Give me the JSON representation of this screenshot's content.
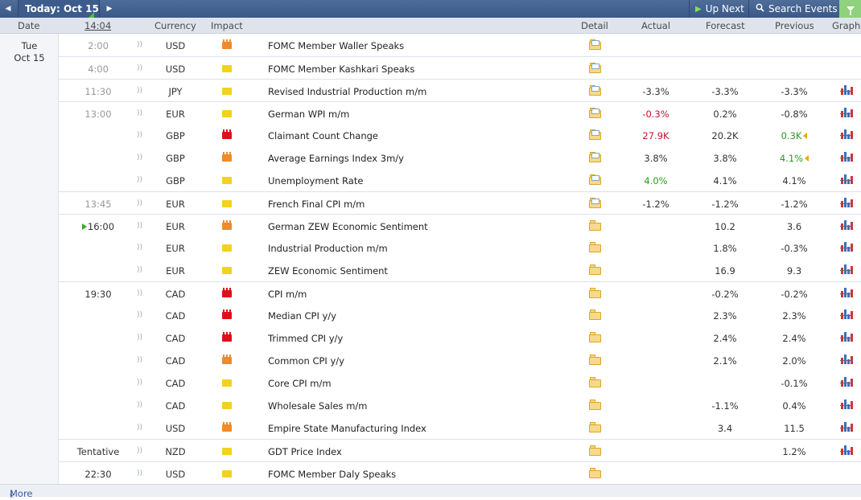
{
  "toolbar": {
    "prev_icon": "◀",
    "next_icon": "▶",
    "date_label": "Today: Oct 15",
    "up_next_label": "Up Next",
    "search_label": "Search Events"
  },
  "header": {
    "date": "Date",
    "time": "14:04",
    "currency": "Currency",
    "impact": "Impact",
    "detail": "Detail",
    "actual": "Actual",
    "forecast": "Forecast",
    "previous": "Previous",
    "graph": "Graph"
  },
  "day": {
    "weekday": "Tue",
    "date": "Oct 15"
  },
  "rows": [
    {
      "time": "2:00",
      "currency": "USD",
      "impact": "med",
      "event": "FOMC Member Waller Speaks",
      "actual": "",
      "actual_color": "",
      "forecast": "",
      "previous": "",
      "prev_color": "",
      "revised": false,
      "graph": false,
      "sep": false
    },
    {
      "time": "4:00",
      "currency": "USD",
      "impact": "low",
      "event": "FOMC Member Kashkari Speaks",
      "actual": "",
      "actual_color": "",
      "forecast": "",
      "previous": "",
      "prev_color": "",
      "revised": false,
      "graph": false,
      "sep": true
    },
    {
      "time": "11:30",
      "currency": "JPY",
      "impact": "low",
      "event": "Revised Industrial Production m/m",
      "actual": "-3.3%",
      "actual_color": "dark",
      "forecast": "-3.3%",
      "previous": "-3.3%",
      "prev_color": "",
      "revised": false,
      "graph": true,
      "sep": true
    },
    {
      "time": "13:00",
      "currency": "EUR",
      "impact": "low",
      "event": "German WPI m/m",
      "actual": "-0.3%",
      "actual_color": "red",
      "forecast": "0.2%",
      "previous": "-0.8%",
      "prev_color": "",
      "revised": false,
      "graph": true,
      "sep": true
    },
    {
      "time": "",
      "currency": "GBP",
      "impact": "high",
      "event": "Claimant Count Change",
      "actual": "27.9K",
      "actual_color": "red",
      "forecast": "20.2K",
      "previous": "0.3K",
      "prev_color": "green",
      "revised": true,
      "graph": true,
      "sep": false
    },
    {
      "time": "",
      "currency": "GBP",
      "impact": "med",
      "event": "Average Earnings Index 3m/y",
      "actual": "3.8%",
      "actual_color": "dark",
      "forecast": "3.8%",
      "previous": "4.1%",
      "prev_color": "green",
      "revised": true,
      "graph": true,
      "sep": false
    },
    {
      "time": "",
      "currency": "GBP",
      "impact": "low",
      "event": "Unemployment Rate",
      "actual": "4.0%",
      "actual_color": "green",
      "forecast": "4.1%",
      "previous": "4.1%",
      "prev_color": "",
      "revised": false,
      "graph": true,
      "sep": false
    },
    {
      "time": "13:45",
      "currency": "EUR",
      "impact": "low",
      "event": "French Final CPI m/m",
      "actual": "-1.2%",
      "actual_color": "dark",
      "forecast": "-1.2%",
      "previous": "-1.2%",
      "prev_color": "",
      "revised": false,
      "graph": true,
      "sep": true
    },
    {
      "time": "16:00",
      "currency": "EUR",
      "impact": "med",
      "event": "German ZEW Economic Sentiment",
      "actual": "",
      "actual_color": "",
      "forecast": "10.2",
      "previous": "3.6",
      "prev_color": "",
      "revised": false,
      "graph": true,
      "sep": true,
      "now": true
    },
    {
      "time": "",
      "currency": "EUR",
      "impact": "low",
      "event": "Industrial Production m/m",
      "actual": "",
      "actual_color": "",
      "forecast": "1.8%",
      "previous": "-0.3%",
      "prev_color": "",
      "revised": false,
      "graph": true,
      "sep": false
    },
    {
      "time": "",
      "currency": "EUR",
      "impact": "low",
      "event": "ZEW Economic Sentiment",
      "actual": "",
      "actual_color": "",
      "forecast": "16.9",
      "previous": "9.3",
      "prev_color": "",
      "revised": false,
      "graph": true,
      "sep": false
    },
    {
      "time": "19:30",
      "currency": "CAD",
      "impact": "high",
      "event": "CPI m/m",
      "actual": "",
      "actual_color": "",
      "forecast": "-0.2%",
      "previous": "-0.2%",
      "prev_color": "",
      "revised": false,
      "graph": true,
      "sep": true,
      "plain": true
    },
    {
      "time": "",
      "currency": "CAD",
      "impact": "high",
      "event": "Median CPI y/y",
      "actual": "",
      "actual_color": "",
      "forecast": "2.3%",
      "previous": "2.3%",
      "prev_color": "",
      "revised": false,
      "graph": true,
      "sep": false
    },
    {
      "time": "",
      "currency": "CAD",
      "impact": "high",
      "event": "Trimmed CPI y/y",
      "actual": "",
      "actual_color": "",
      "forecast": "2.4%",
      "previous": "2.4%",
      "prev_color": "",
      "revised": false,
      "graph": true,
      "sep": false
    },
    {
      "time": "",
      "currency": "CAD",
      "impact": "med",
      "event": "Common CPI y/y",
      "actual": "",
      "actual_color": "",
      "forecast": "2.1%",
      "previous": "2.0%",
      "prev_color": "",
      "revised": false,
      "graph": true,
      "sep": false
    },
    {
      "time": "",
      "currency": "CAD",
      "impact": "low",
      "event": "Core CPI m/m",
      "actual": "",
      "actual_color": "",
      "forecast": "",
      "previous": "-0.1%",
      "prev_color": "",
      "revised": false,
      "graph": true,
      "sep": false
    },
    {
      "time": "",
      "currency": "CAD",
      "impact": "low",
      "event": "Wholesale Sales m/m",
      "actual": "",
      "actual_color": "",
      "forecast": "-1.1%",
      "previous": "0.4%",
      "prev_color": "",
      "revised": false,
      "graph": true,
      "sep": false
    },
    {
      "time": "",
      "currency": "USD",
      "impact": "med",
      "event": "Empire State Manufacturing Index",
      "actual": "",
      "actual_color": "",
      "forecast": "3.4",
      "previous": "11.5",
      "prev_color": "",
      "revised": false,
      "graph": true,
      "sep": false
    },
    {
      "time": "Tentative",
      "currency": "NZD",
      "impact": "low",
      "event": "GDT Price Index",
      "actual": "",
      "actual_color": "",
      "forecast": "",
      "previous": "1.2%",
      "prev_color": "",
      "revised": false,
      "graph": true,
      "sep": true,
      "plain": true
    },
    {
      "time": "22:30",
      "currency": "USD",
      "impact": "low",
      "event": "FOMC Member Daly Speaks",
      "actual": "",
      "actual_color": "",
      "forecast": "",
      "previous": "",
      "prev_color": "",
      "revised": false,
      "graph": false,
      "sep": true,
      "plain": true
    }
  ],
  "more_label": "More"
}
